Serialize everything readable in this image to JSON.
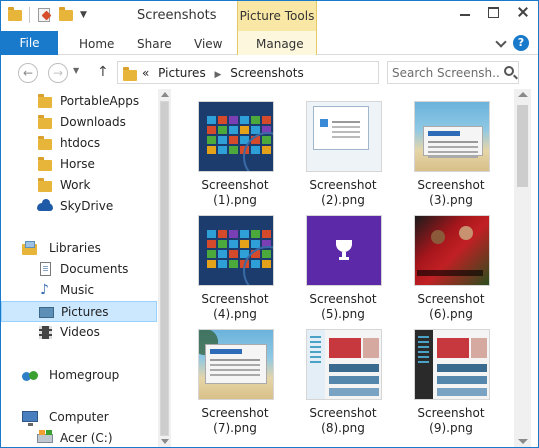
{
  "window": {
    "title": "Screenshots",
    "contextual_group": "Picture Tools"
  },
  "ribbon": {
    "tabs": [
      "File",
      "Home",
      "Share",
      "View",
      "Manage"
    ],
    "help": "?"
  },
  "address": {
    "overflow": "«",
    "crumbs": [
      "Pictures",
      "Screenshots"
    ],
    "search_placeholder": "Search Screensh..."
  },
  "nav": {
    "favorites": [
      {
        "label": "PortableApps",
        "icon": "folder-icon"
      },
      {
        "label": "Downloads",
        "icon": "folder-icon"
      },
      {
        "label": "htdocs",
        "icon": "folder-icon"
      },
      {
        "label": "Horse",
        "icon": "folder-icon"
      },
      {
        "label": "Work",
        "icon": "folder-icon"
      },
      {
        "label": "SkyDrive",
        "icon": "skydrive-icon"
      }
    ],
    "libraries": {
      "label": "Libraries",
      "items": [
        {
          "label": "Documents",
          "icon": "documents-icon"
        },
        {
          "label": "Music",
          "icon": "music-icon"
        },
        {
          "label": "Pictures",
          "icon": "pictures-icon",
          "selected": true
        },
        {
          "label": "Videos",
          "icon": "videos-icon"
        }
      ]
    },
    "homegroup": "Homegroup",
    "computer": "Computer",
    "drive": "Acer (C:)"
  },
  "files": [
    {
      "line1": "Screenshot",
      "line2": "(1).png",
      "thumb": "start-screen"
    },
    {
      "line1": "Screenshot",
      "line2": "(2).png",
      "thumb": "settings-window"
    },
    {
      "line1": "Screenshot",
      "line2": "(3).png",
      "thumb": "beach-desktop"
    },
    {
      "line1": "Screenshot",
      "line2": "(4).png",
      "thumb": "start-screen"
    },
    {
      "line1": "Screenshot",
      "line2": "(5).png",
      "thumb": "purple-trophy"
    },
    {
      "line1": "Screenshot",
      "line2": "(6).png",
      "thumb": "soccer-app"
    },
    {
      "line1": "Screenshot",
      "line2": "(7).png",
      "thumb": "beach-desktop-window"
    },
    {
      "line1": "Screenshot",
      "line2": "(8).png",
      "thumb": "store-app"
    },
    {
      "line1": "Screenshot",
      "line2": "(9).png",
      "thumb": "store-app-dark"
    }
  ],
  "colors": {
    "accent": "#1979ca",
    "contextual": "#f8e7a5",
    "selection": "#cce8ff"
  }
}
